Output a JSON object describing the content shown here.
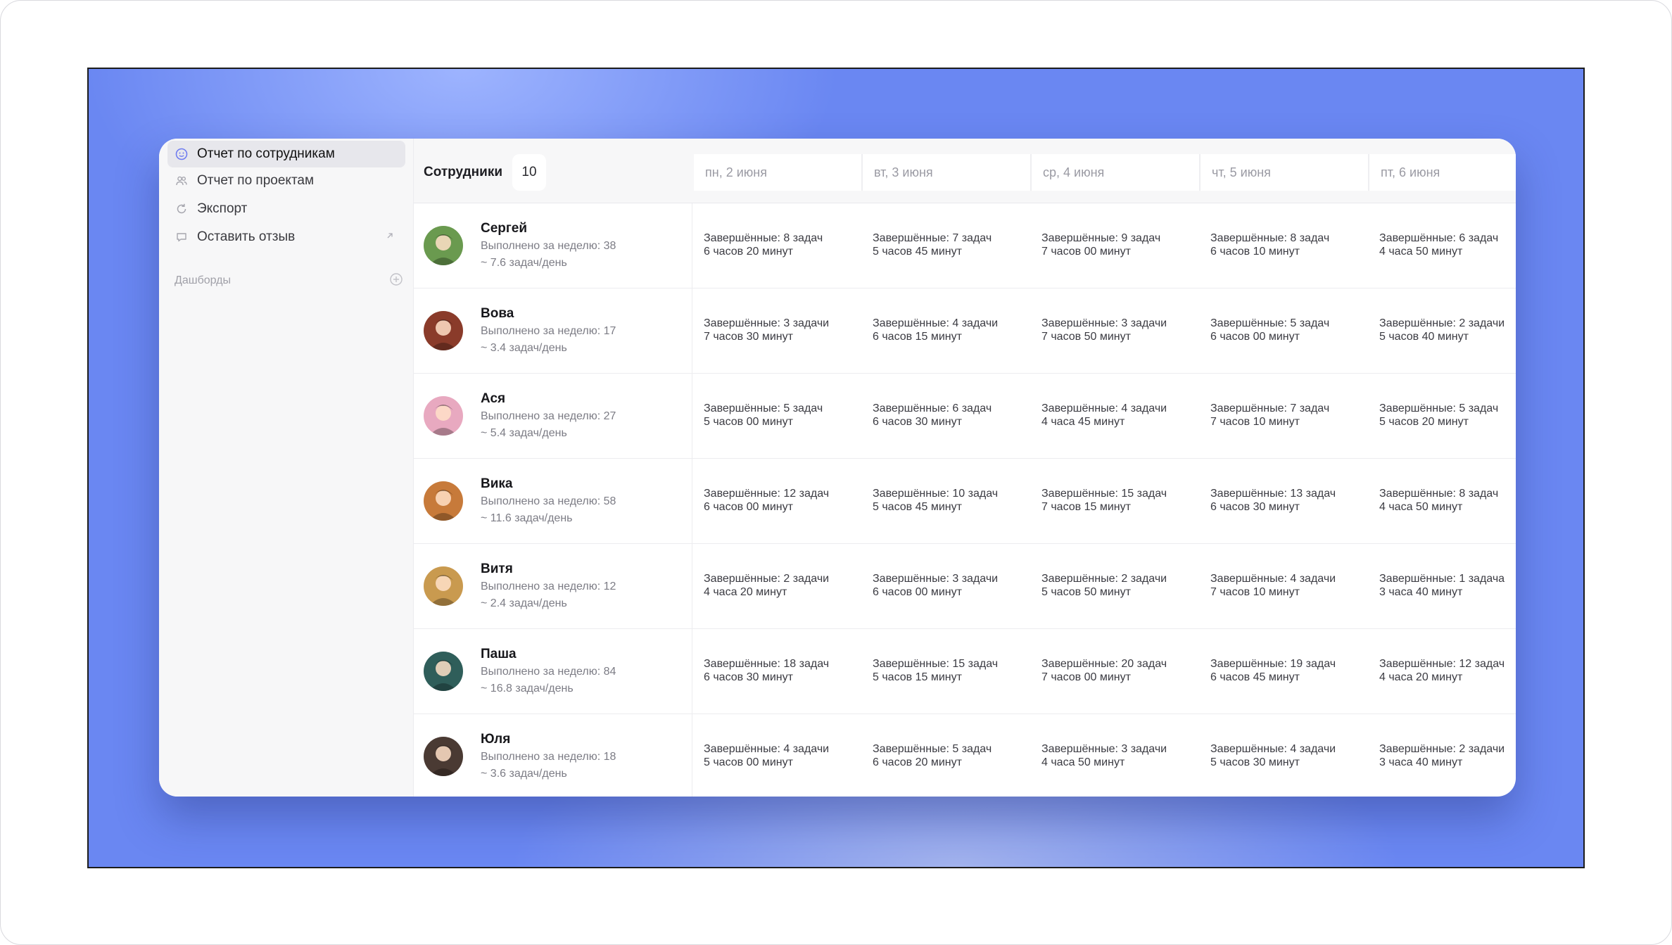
{
  "sidebar": {
    "items": [
      {
        "label": "Отчет по сотрудникам",
        "icon": "smile-icon",
        "active": true
      },
      {
        "label": "Отчет по проектам",
        "icon": "people-icon",
        "active": false
      },
      {
        "label": "Экспорт",
        "icon": "refresh-icon",
        "active": false
      },
      {
        "label": "Оставить отзыв",
        "icon": "comment-icon",
        "active": false
      }
    ],
    "section_label": "Дашборды"
  },
  "table": {
    "title": "Сотрудники",
    "count": "10",
    "days": [
      "пн, 2 июня",
      "вт, 3 июня",
      "ср, 4 июня",
      "чт, 5 июня",
      "пт, 6 июня"
    ],
    "rows": [
      {
        "name": "Сергей",
        "week": "Выполнено за неделю: 38",
        "rate": "~ 7.6 задач/день",
        "avatar_color": "#6a9a4f",
        "days": [
          [
            "Завершённые: 8 задач",
            "6 часов 20 минут"
          ],
          [
            "Завершённые: 7 задач",
            "5 часов 45 минут"
          ],
          [
            "Завершённые: 9 задач",
            "7 часов 00 минут"
          ],
          [
            "Завершённые: 8 задач",
            "6 часов 10 минут"
          ],
          [
            "Завершённые: 6 задач",
            "4 часа 50 минут"
          ]
        ]
      },
      {
        "name": "Вова",
        "week": "Выполнено за неделю: 17",
        "rate": "~ 3.4 задач/день",
        "avatar_color": "#8a3b2a",
        "days": [
          [
            "Завершённые: 3 задачи",
            "7 часов 30 минут"
          ],
          [
            "Завершённые: 4 задачи",
            "6 часов 15 минут"
          ],
          [
            "Завершённые: 3 задачи",
            "7 часов 50 минут"
          ],
          [
            "Завершённые: 5 задач",
            "6 часов 00 минут"
          ],
          [
            "Завершённые: 2 задачи",
            "5 часов 40 минут"
          ]
        ]
      },
      {
        "name": "Ася",
        "week": "Выполнено за неделю: 27",
        "rate": "~ 5.4 задач/день",
        "avatar_color": "#e8a9c0",
        "days": [
          [
            "Завершённые: 5 задач",
            "5 часов 00 минут"
          ],
          [
            "Завершённые: 6 задач",
            "6 часов 30 минут"
          ],
          [
            "Завершённые: 4 задачи",
            "4 часа 45 минут"
          ],
          [
            "Завершённые: 7 задач",
            "7 часов 10 минут"
          ],
          [
            "Завершённые: 5 задач",
            "5 часов 20 минут"
          ]
        ]
      },
      {
        "name": "Вика",
        "week": "Выполнено за неделю: 58",
        "rate": "~ 11.6 задач/день",
        "avatar_color": "#c77a3a",
        "days": [
          [
            "Завершённые: 12 задач",
            "6 часов 00 минут"
          ],
          [
            "Завершённые: 10 задач",
            "5 часов 45 минут"
          ],
          [
            "Завершённые: 15 задач",
            "7 часов 15 минут"
          ],
          [
            "Завершённые: 13 задач",
            "6 часов 30 минут"
          ],
          [
            "Завершённые: 8 задач",
            "4 часа 50 минут"
          ]
        ]
      },
      {
        "name": "Витя",
        "week": "Выполнено за неделю: 12",
        "rate": "~ 2.4 задач/день",
        "avatar_color": "#c99a4f",
        "days": [
          [
            "Завершённые: 2 задачи",
            "4 часа 20 минут"
          ],
          [
            "Завершённые: 3 задачи",
            "6 часов 00 минут"
          ],
          [
            "Завершённые: 2 задачи",
            "5 часов 50 минут"
          ],
          [
            "Завершённые: 4 задачи",
            "7 часов 10 минут"
          ],
          [
            "Завершённые: 1 задача",
            "3 часа 40 минут"
          ]
        ]
      },
      {
        "name": "Паша",
        "week": "Выполнено за неделю: 84",
        "rate": "~ 16.8 задач/день",
        "avatar_color": "#2f5e5a",
        "days": [
          [
            "Завершённые: 18 задач",
            "6 часов 30 минут"
          ],
          [
            "Завершённые: 15 задач",
            "5 часов 15 минут"
          ],
          [
            "Завершённые: 20 задач",
            "7 часов 00 минут"
          ],
          [
            "Завершённые: 19 задач",
            "6 часов 45 минут"
          ],
          [
            "Завершённые: 12 задач",
            "4 часа 20 минут"
          ]
        ]
      },
      {
        "name": "Юля",
        "week": "Выполнено за неделю: 18",
        "rate": "~ 3.6 задач/день",
        "avatar_color": "#4a3a33",
        "days": [
          [
            "Завершённые: 4 задачи",
            "5 часов 00 минут"
          ],
          [
            "Завершённые: 5 задач",
            "6 часов 20 минут"
          ],
          [
            "Завершённые: 3 задачи",
            "4 часа 50 минут"
          ],
          [
            "Завершённые: 4 задачи",
            "5 часов 30 минут"
          ],
          [
            "Завершённые: 2 задачи",
            "3 часа 40 минут"
          ]
        ]
      }
    ]
  }
}
